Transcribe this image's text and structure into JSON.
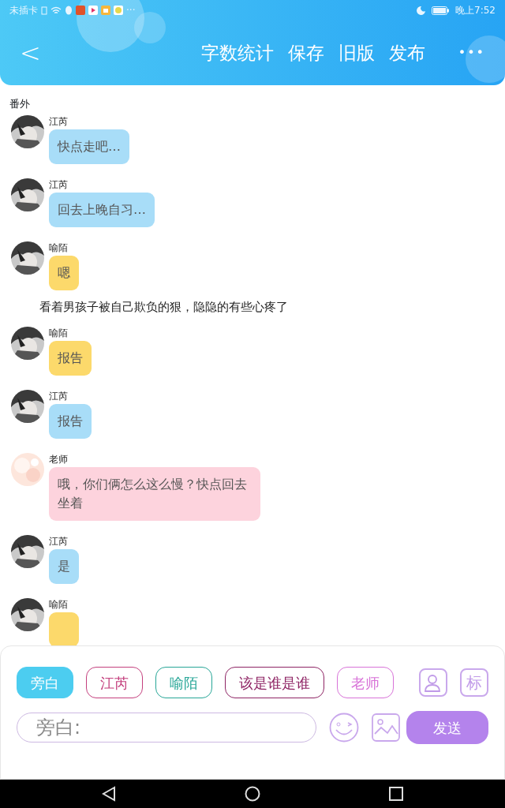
{
  "status_bar": {
    "carrier": "未插卡",
    "more": "···",
    "time": "晚上7:52"
  },
  "header": {
    "back": "<",
    "actions": [
      "字数统计",
      "保存",
      "旧版",
      "发布"
    ],
    "more": "•••"
  },
  "chapter": "番外",
  "messages": [
    {
      "kind": "message",
      "sender": "江芮",
      "text": "快点走吧…",
      "color": "#a8ddf8"
    },
    {
      "kind": "message",
      "sender": "江芮",
      "text": "回去上晚自习…",
      "color": "#a8ddf8"
    },
    {
      "kind": "message",
      "sender": "喻陌",
      "text": "嗯",
      "color": "#fcd96b"
    },
    {
      "kind": "narration",
      "text": "看着男孩子被自己欺负的狠，隐隐的有些心疼了"
    },
    {
      "kind": "message",
      "sender": "喻陌",
      "text": "报告",
      "color": "#fcd96b"
    },
    {
      "kind": "message",
      "sender": "江芮",
      "text": "报告",
      "color": "#a8ddf8"
    },
    {
      "kind": "message",
      "sender": "老师",
      "text": "哦，你们俩怎么这么慢？快点回去坐着",
      "color": "#fdd3dd"
    },
    {
      "kind": "message",
      "sender": "江芮",
      "text": "是",
      "color": "#a8ddf8"
    },
    {
      "kind": "message",
      "sender": "喻陌",
      "color": "#fcd96b"
    }
  ],
  "composer": {
    "roles": [
      {
        "label": "旁白",
        "selected": true,
        "color": "#4ccdf0"
      },
      {
        "label": "江芮",
        "selected": false,
        "color": "#c4407e"
      },
      {
        "label": "喻陌",
        "selected": false,
        "color": "#27a697"
      },
      {
        "label": "该是谁是谁",
        "selected": false,
        "color": "#8e2464"
      },
      {
        "label": "老师",
        "selected": false,
        "color": "#d873d8"
      }
    ],
    "tag_button": "标",
    "placeholder": "旁白:",
    "send": "发送"
  }
}
